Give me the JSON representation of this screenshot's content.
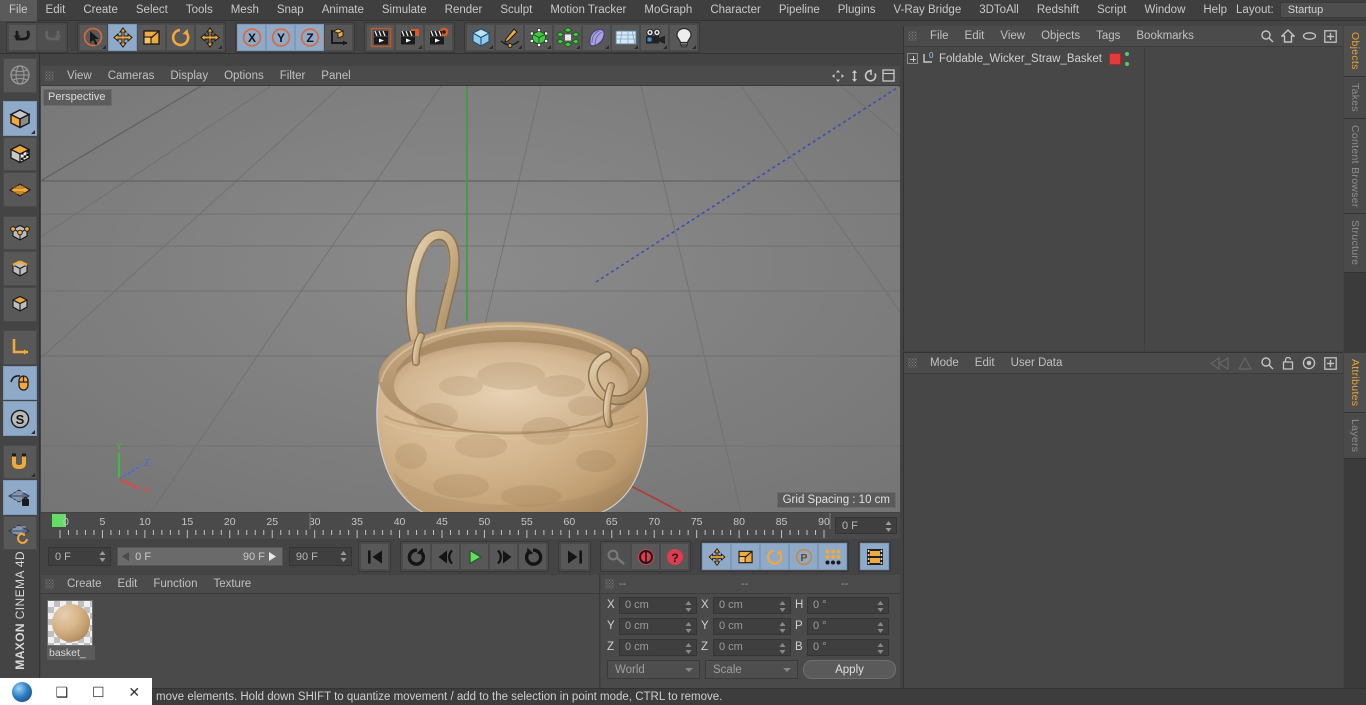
{
  "menubar": {
    "items": [
      "File",
      "Edit",
      "Create",
      "Select",
      "Tools",
      "Mesh",
      "Snap",
      "Animate",
      "Simulate",
      "Render",
      "Sculpt",
      "Motion Tracker",
      "MoGraph",
      "Character",
      "Pipeline",
      "Plugins",
      "V-Ray Bridge",
      "3DToAll",
      "Redshift",
      "Script",
      "Window",
      "Help"
    ],
    "layout_label": "Layout:",
    "layout_value": "Startup",
    "search_icon": "search-icon"
  },
  "toolbar": {
    "groups": [
      {
        "name": "undo-redo",
        "buttons": [
          {
            "name": "undo-button",
            "icon": "undo-arrow-icon",
            "state": "normal"
          },
          {
            "name": "redo-button",
            "icon": "redo-arrow-icon",
            "state": "disabled"
          }
        ]
      },
      {
        "name": "selection-transform",
        "buttons": [
          {
            "name": "live-selection-button",
            "icon": "cursor-select-icon",
            "state": "normal"
          },
          {
            "name": "move-tool-button",
            "icon": "move-arrows-icon",
            "state": "active"
          },
          {
            "name": "scale-tool-button",
            "icon": "scale-box-icon",
            "state": "normal"
          },
          {
            "name": "rotate-tool-button",
            "icon": "rotate-circle-icon",
            "state": "normal"
          },
          {
            "name": "move-duplicate-button",
            "icon": "move-arrows-icon",
            "state": "normal"
          }
        ]
      },
      {
        "name": "axis-locks",
        "buttons": [
          {
            "name": "x-axis-lock-button",
            "icon": "x-axis-icon",
            "state": "active"
          },
          {
            "name": "y-axis-lock-button",
            "icon": "y-axis-icon",
            "state": "active"
          },
          {
            "name": "z-axis-lock-button",
            "icon": "z-axis-icon",
            "state": "active"
          },
          {
            "name": "world-object-coord-button",
            "icon": "world-axis-cube-icon",
            "state": "normal"
          }
        ]
      },
      {
        "name": "render-group",
        "buttons": [
          {
            "name": "render-view-button",
            "icon": "clapperboard-view-icon",
            "state": "normal"
          },
          {
            "name": "render-to-picture-viewer-button",
            "icon": "clapperboard-picture-icon",
            "state": "normal"
          },
          {
            "name": "render-settings-button",
            "icon": "clapperboard-gear-icon",
            "state": "normal"
          }
        ]
      },
      {
        "name": "create-objects",
        "buttons": [
          {
            "name": "add-cube-button",
            "icon": "blue-cube-icon",
            "state": "normal"
          },
          {
            "name": "add-spline-button",
            "icon": "pen-spline-icon",
            "state": "normal"
          },
          {
            "name": "add-generator-button",
            "icon": "green-cube-icon",
            "state": "normal"
          },
          {
            "name": "add-mograph-button",
            "icon": "cloner-cluster-icon",
            "state": "normal"
          },
          {
            "name": "add-deformer-button",
            "icon": "bend-deformer-icon",
            "state": "normal"
          },
          {
            "name": "add-scene-object-button",
            "icon": "floor-grid-icon",
            "state": "normal"
          },
          {
            "name": "add-camera-button",
            "icon": "camera-icon",
            "state": "normal"
          },
          {
            "name": "add-light-button",
            "icon": "light-bulb-icon",
            "state": "normal"
          }
        ]
      }
    ]
  },
  "left_toolbar": {
    "buttons": [
      {
        "name": "make-editable-button",
        "icon": "globe-wireframe-icon",
        "state": "normal"
      },
      {
        "name": "model-mode-button",
        "icon": "solid-cube-icon",
        "state": "active"
      },
      {
        "name": "texture-mode-button",
        "icon": "checker-cube-icon",
        "state": "normal"
      },
      {
        "name": "uv-mesh-mode-button",
        "icon": "uv-mesh-icon",
        "state": "normal"
      },
      {
        "name": "point-mode-button",
        "icon": "point-cube-icon",
        "state": "normal"
      },
      {
        "name": "edge-mode-button",
        "icon": "edge-cube-icon",
        "state": "normal"
      },
      {
        "name": "polygon-mode-button",
        "icon": "polygon-cube-icon",
        "state": "normal"
      },
      {
        "name": "axis-modify-button",
        "icon": "axis-l-icon",
        "state": "normal"
      },
      {
        "name": "enable-axis-button",
        "icon": "mouse-axis-icon",
        "state": "active"
      },
      {
        "name": "soft-selection-button",
        "icon": "s-circle-icon",
        "state": "active"
      },
      {
        "name": "snap-magnet-button",
        "icon": "magnet-icon",
        "state": "normal"
      },
      {
        "name": "workplane-lock-button",
        "icon": "grid-lock-icon",
        "state": "active"
      },
      {
        "name": "workplane-align-button",
        "icon": "grid-rotate-icon",
        "state": "normal"
      }
    ],
    "brand_bold": "MAXON",
    "brand_light": "CINEMA 4D"
  },
  "viewport": {
    "menu_items": [
      "View",
      "Cameras",
      "Display",
      "Options",
      "Filter",
      "Panel"
    ],
    "header_icons": [
      "pan-move-icon",
      "zoom-vertical-icon",
      "rotate-view-icon",
      "maximize-view-icon"
    ],
    "perspective_label": "Perspective",
    "grid_spacing_label": "Grid Spacing : 10 cm",
    "axis_labels": {
      "x": "X",
      "y": "Y",
      "z": "Z"
    },
    "object_description": "foldable wicker straw basket 3D model"
  },
  "timeline": {
    "ticks": [
      {
        "label": "0",
        "value": 0
      },
      {
        "label": "5",
        "value": 5
      },
      {
        "label": "10",
        "value": 10
      },
      {
        "label": "15",
        "value": 15
      },
      {
        "label": "20",
        "value": 20
      },
      {
        "label": "25",
        "value": 25
      },
      {
        "label": "30",
        "value": 30
      },
      {
        "label": "35",
        "value": 35
      },
      {
        "label": "40",
        "value": 40
      },
      {
        "label": "45",
        "value": 45
      },
      {
        "label": "50",
        "value": 50
      },
      {
        "label": "55",
        "value": 55
      },
      {
        "label": "60",
        "value": 60
      },
      {
        "label": "65",
        "value": 65
      },
      {
        "label": "70",
        "value": 70
      },
      {
        "label": "75",
        "value": 75
      },
      {
        "label": "80",
        "value": 80
      },
      {
        "label": "85",
        "value": 85
      },
      {
        "label": "90",
        "value": 90
      }
    ],
    "range_start": 0,
    "range_end": 90,
    "playhead_frame": 0,
    "current_frame_field": "0 F"
  },
  "transport": {
    "current_frame": "0 F",
    "preview_min": "0 F",
    "preview_max": "90 F",
    "end_frame": "90 F",
    "buttons": [
      {
        "name": "go-to-start-button",
        "icon": "skip-start-icon",
        "state": "normal"
      },
      {
        "name": "play-forward-loop-button",
        "icon": "loop-arrow-icon",
        "state": "normal"
      },
      {
        "name": "step-back-button",
        "icon": "prev-frame-icon",
        "state": "normal"
      },
      {
        "name": "play-button",
        "icon": "play-triangle-icon",
        "state": "normal"
      },
      {
        "name": "step-forward-button",
        "icon": "next-frame-icon",
        "state": "normal"
      },
      {
        "name": "loop-playback-button",
        "icon": "loop-round-icon",
        "state": "normal"
      },
      {
        "name": "go-to-end-button",
        "icon": "skip-end-icon",
        "state": "normal"
      },
      {
        "name": "record-keyframe-button",
        "icon": "key-icon",
        "state": "disabled"
      },
      {
        "name": "autokeying-button",
        "icon": "red-circle-arrows-icon",
        "state": "normal"
      },
      {
        "name": "keyframe-selection-button",
        "icon": "red-question-icon",
        "state": "normal"
      },
      {
        "name": "position-key-button",
        "icon": "move-arrows-icon",
        "state": "active"
      },
      {
        "name": "scale-key-button",
        "icon": "scale-box-icon",
        "state": "active"
      },
      {
        "name": "rotation-key-button",
        "icon": "rotate-circle-icon",
        "state": "active"
      },
      {
        "name": "param-key-button",
        "icon": "p-circle-icon",
        "state": "active"
      },
      {
        "name": "point-level-animation-button",
        "icon": "dot-grid-icon",
        "state": "active"
      },
      {
        "name": "timeline-mode-button",
        "icon": "filmstrip-icon",
        "state": "active"
      }
    ]
  },
  "material_manager": {
    "menu_items": [
      "Create",
      "Edit",
      "Function",
      "Texture"
    ],
    "materials": [
      {
        "name": "basket_",
        "preview": "tan-sphere-preview"
      }
    ]
  },
  "coordinates": {
    "header_dashes": [
      "--",
      "--",
      "--"
    ],
    "position_label_x": "X",
    "position_label_y": "Y",
    "position_label_z": "Z",
    "size_label_x": "X",
    "size_label_y": "Y",
    "size_label_z": "Z",
    "rot_label_h": "H",
    "rot_label_p": "P",
    "rot_label_b": "B",
    "position": {
      "x": "0 cm",
      "y": "0 cm",
      "z": "0 cm"
    },
    "size": {
      "x": "0 cm",
      "y": "0 cm",
      "z": "0 cm"
    },
    "rotation": {
      "h": "0 °",
      "p": "0 °",
      "b": "0 °"
    },
    "coord_system": "World",
    "size_mode": "Scale",
    "apply_label": "Apply"
  },
  "object_manager": {
    "menu_items": [
      "File",
      "Edit",
      "View",
      "Objects",
      "Tags",
      "Bookmarks"
    ],
    "header_icons": [
      "search-icon",
      "home-icon",
      "eye-icon",
      "plus-box-icon"
    ],
    "objects": [
      {
        "name": "Foldable_Wicker_Straw_Basket",
        "icon": "null-object-icon",
        "tag_color": "#e23b3b"
      }
    ]
  },
  "attribute_manager": {
    "menu_items": [
      "Mode",
      "Edit",
      "User Data"
    ],
    "header_icons": [
      "back-arrow-icon",
      "forward-arrow-icon",
      "search-icon",
      "lock-icon",
      "target-icon",
      "plus-box-icon"
    ]
  },
  "right_tabs": {
    "top": [
      {
        "label": "Objects",
        "active": true
      },
      {
        "label": "Takes",
        "active": false
      },
      {
        "label": "Content Browser",
        "active": false
      },
      {
        "label": "Structure",
        "active": false
      }
    ],
    "bottom": [
      {
        "label": "Attributes",
        "active": true
      },
      {
        "label": "Layers",
        "active": false
      }
    ]
  },
  "statusbar": {
    "message": "move elements. Hold down SHIFT to quantize movement / add to the selection in point mode, CTRL to remove."
  },
  "taskbar": {
    "buttons": [
      "app-orb-icon",
      "restore-window-icon",
      "maximize-window-icon",
      "close-window-icon"
    ]
  },
  "colors": {
    "accent_orange": "#e3a53c",
    "active_blue": "#8fa9c9",
    "panel_bg": "#474747",
    "viewport_bg": "#7d7d7d",
    "tag_red": "#e23b3b",
    "axis_x": "#cc4444",
    "axis_y": "#44bb44",
    "axis_z": "#4466cc"
  }
}
